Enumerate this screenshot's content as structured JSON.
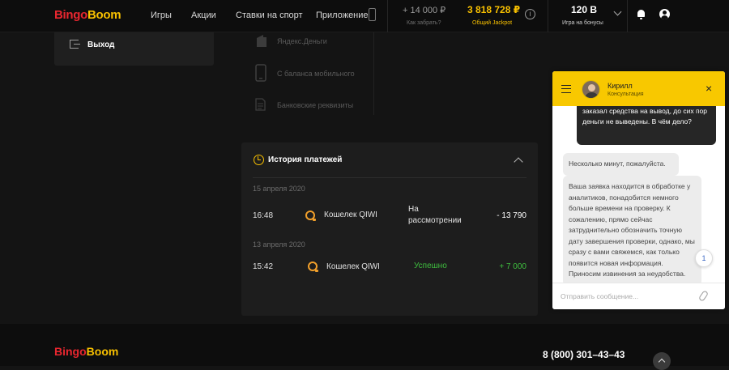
{
  "header": {
    "logo_part1": "Bingo",
    "logo_part2": "Boom",
    "nav": [
      "Игры",
      "Акции",
      "Ставки на спорт",
      "Приложение"
    ],
    "winnings_amount": "+ 14 000 ₽",
    "winnings_label": "Как забрать?",
    "jackpot_amount": "3 818 728 ₽",
    "jackpot_label": "Общий Jackpot",
    "info_icon_glyph": "i",
    "balance_amount": "120 B",
    "balance_label": "Игра на бонусы"
  },
  "sidebar": {
    "exit_label": "Выход"
  },
  "payment_methods": [
    {
      "label": "Яндекс.Деньги",
      "icon": "yandex-money-icon"
    },
    {
      "label": "С баланса мобильного",
      "icon": "mobile-phone-icon"
    },
    {
      "label": "Банковские реквизиты",
      "icon": "bank-document-icon"
    }
  ],
  "history": {
    "title": "История платежей",
    "groups": [
      {
        "date": "15 апреля 2020",
        "time": "16:48",
        "method": "Кошелек QIWI",
        "status_line1": "На",
        "status_line2": "рассмотрении",
        "amount": "- 13 790"
      },
      {
        "date": "13 апреля 2020",
        "time": "15:42",
        "method": "Кошелек QIWI",
        "status": "Успешно",
        "amount": "+ 7 000"
      }
    ]
  },
  "footer": {
    "logo_part1": "Bingo",
    "logo_part2": "Boom",
    "phone": "8 (800) 301–43–43"
  },
  "chat": {
    "agent_name": "Кирилл",
    "agent_role": "Консультация",
    "close_glyph": "×",
    "messages": [
      {
        "from": "user",
        "text": "заказал средства на вывод, до сих пор деньги не выведены. В чём дело?"
      },
      {
        "from": "agent",
        "text": "Несколько минут, пожалуйста."
      },
      {
        "from": "agent",
        "text": "Ваша заявка находится в обработке у аналитиков, понадобится немного больше времени на проверку. К сожалению, прямо сейчас затруднительно обозначить точную дату завершения проверки, однако, мы сразу с вами свяжемся, как только появится новая информация. Приносим извинения за неудобства."
      }
    ],
    "unread_count": "1",
    "input_placeholder": "Отправить сообщение..."
  },
  "colors": {
    "brand_red": "#e8262f",
    "brand_yellow": "#f8c000",
    "success_green": "#3fbf3f",
    "chat_header": "#f8c800"
  }
}
